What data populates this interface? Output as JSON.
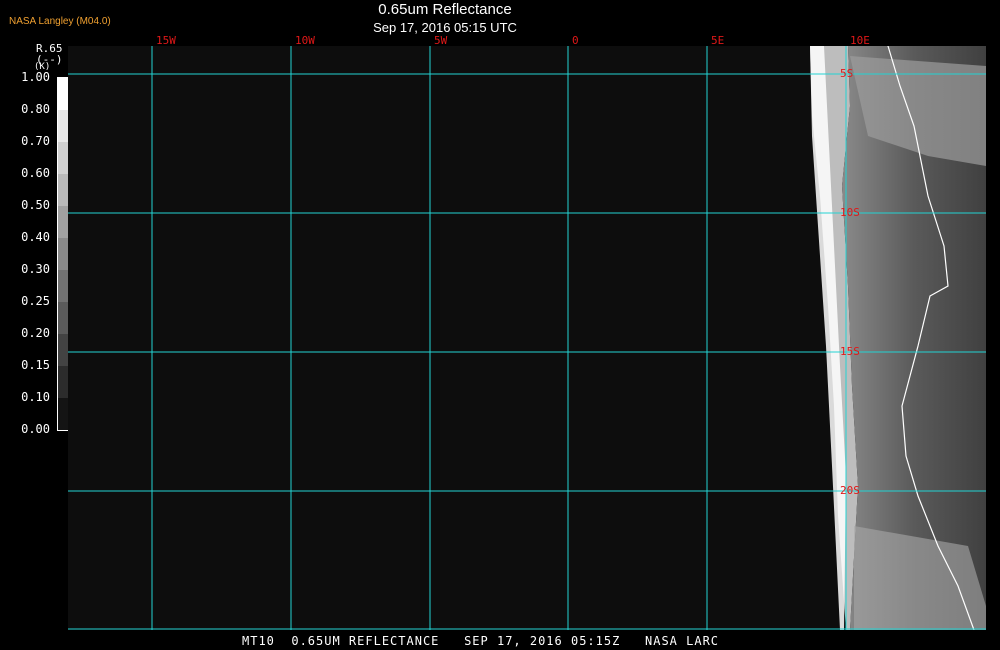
{
  "header": {
    "source": "NASA Langley (M04.0)",
    "title": "0.65um Reflectance",
    "subtitle": "Sep 17, 2016 05:15 UTC"
  },
  "colorbar": {
    "name": "R.65",
    "unit": "(K)",
    "unit_sub": "(--)",
    "ticks": [
      "1.00",
      "0.80",
      "0.70",
      "0.60",
      "0.50",
      "0.40",
      "0.30",
      "0.25",
      "0.20",
      "0.15",
      "0.10",
      "0.00"
    ]
  },
  "map": {
    "lon_labels": [
      "15W",
      "10W",
      "5W",
      "0",
      "5E",
      "10E"
    ],
    "lat_labels": [
      "5S",
      "10S",
      "15S",
      "20S"
    ],
    "grid_color": "#22d3d3",
    "label_color": "#e01818"
  },
  "footer": "MT10  0.65UM REFLECTANCE   SEP 17, 2016 05:15Z   NASA LARC"
}
